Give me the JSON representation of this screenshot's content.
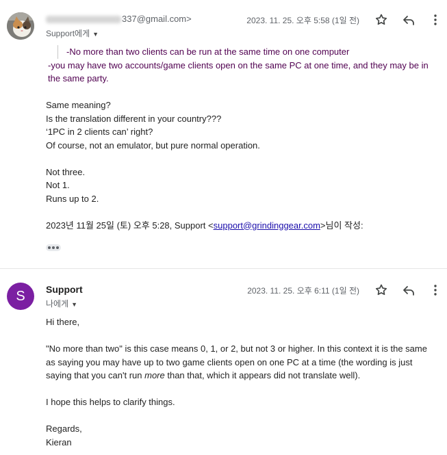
{
  "message1": {
    "sender_email_suffix": "337@gmail.com>",
    "recipient": "Support에게",
    "date": "2023. 11. 25. 오후 5:58 (1일 전)",
    "quoted_line": "-No more than two clients can be run at the same time on one computer",
    "purple_line": "-you may have two accounts/game clients open on the same PC at one time, and they may be in the same party.",
    "lines_block1": [
      "Same meaning?",
      "Is the translation different in your country???",
      "‘1PC in 2 clients can’ right?",
      "Of course, not an emulator, but pure normal operation."
    ],
    "lines_block2": [
      "Not three.",
      "Not 1.",
      "Runs up to 2."
    ],
    "reply_header_prefix": "2023년 11월 25일 (토) 오후 5:28, Support <",
    "reply_header_link": "support@grindinggear.com",
    "reply_header_suffix": ">님이 작성:"
  },
  "message2": {
    "avatar_letter": "S",
    "sender_name": "Support",
    "recipient": "나에게",
    "date": "2023. 11. 25. 오후 6:11 (1일 전)",
    "greeting": "Hi there,",
    "para1_a": "\"No more than two\" is this case means 0, 1, or 2, but not 3 or higher. In this context it is the same as saying you may have up to two game clients open on one PC at a time (the wording is just saying that you can't run ",
    "para1_em": "more",
    "para1_b": " than that, which it appears did not translate well).",
    "para2": "I hope this helps to clarify things.",
    "sign1": "Regards,",
    "sign2": "Kieran"
  },
  "icons": [
    "star-icon",
    "reply-icon",
    "more-vert-icon"
  ]
}
